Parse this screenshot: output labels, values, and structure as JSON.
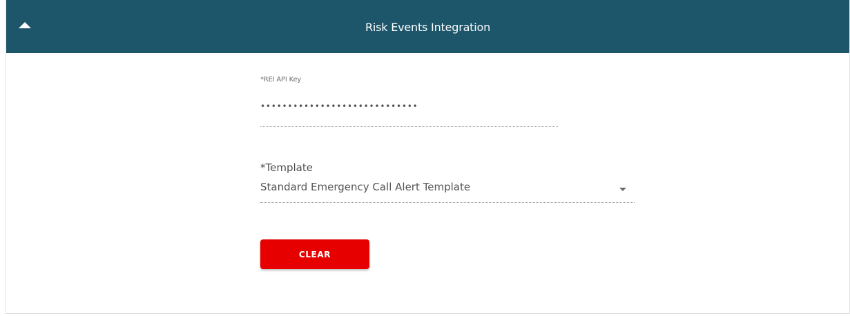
{
  "header": {
    "title": "Risk Events Integration",
    "collapse_icon": "caret-up-icon",
    "background_color": "#1d566b"
  },
  "form": {
    "api_key": {
      "label": "*REI API Key",
      "value": "•••••••••••••••••••••••••••••"
    },
    "template": {
      "label": "*Template",
      "selected": "Standard Emergency Call Alert Template",
      "dropdown_icon": "caret-down-icon"
    },
    "clear_button": {
      "label": "CLEAR",
      "color": "#e60000"
    }
  }
}
